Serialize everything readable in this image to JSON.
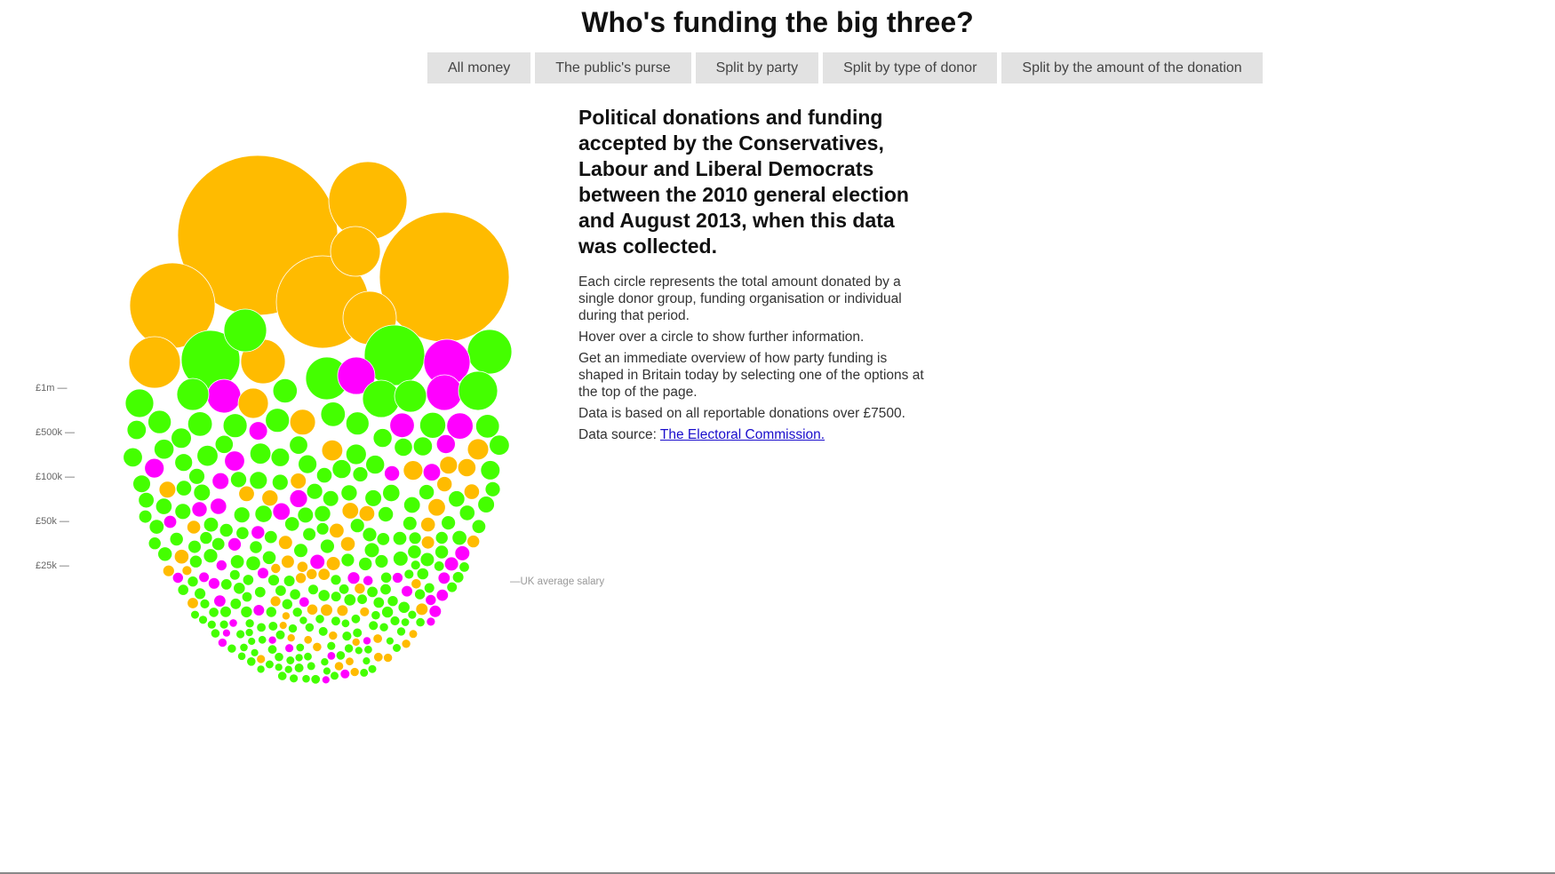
{
  "header": {
    "title": "Who's funding the big three?"
  },
  "tabs": [
    {
      "label": "All money"
    },
    {
      "label": "The public's purse"
    },
    {
      "label": "Split by party"
    },
    {
      "label": "Split by type of donor"
    },
    {
      "label": "Split by the amount of the donation"
    }
  ],
  "intro": {
    "heading": "Political donations and funding accepted by the Conservatives, Labour and Liberal Democrats between the 2010 general election and August 2013, when this data was collected.",
    "p1": "Each circle represents the total amount donated by a single donor group, funding organisation or individual during that period.",
    "p2": "Hover over a circle to show further information.",
    "p3": "Get an immediate overview of how party funding is shaped in Britain today by selecting one of the options at the top of the page.",
    "p4": "Data is based on all reportable donations over £7500.",
    "source_prefix": "Data source: ",
    "source_link": "The Electoral Commission."
  },
  "colors": {
    "orange": "#ffbb00",
    "green": "#44ff00",
    "magenta": "#ff00ff",
    "axis_text": "#666666",
    "annotation_text": "#999999"
  },
  "chart_data": {
    "type": "bubble",
    "axis_labels": [
      "£1m —",
      "£500k —",
      "£100k —",
      "£50k —",
      "£25k —"
    ],
    "annotation": "—UK average salary",
    "bands": [
      {
        "level": "£1m",
        "min_value": 1000000
      },
      {
        "level": "£500k",
        "min_value": 500000
      },
      {
        "level": "£100k",
        "min_value": 100000
      },
      {
        "level": "£50k",
        "min_value": 50000
      },
      {
        "level": "£25k",
        "min_value": 25000
      }
    ]
  }
}
